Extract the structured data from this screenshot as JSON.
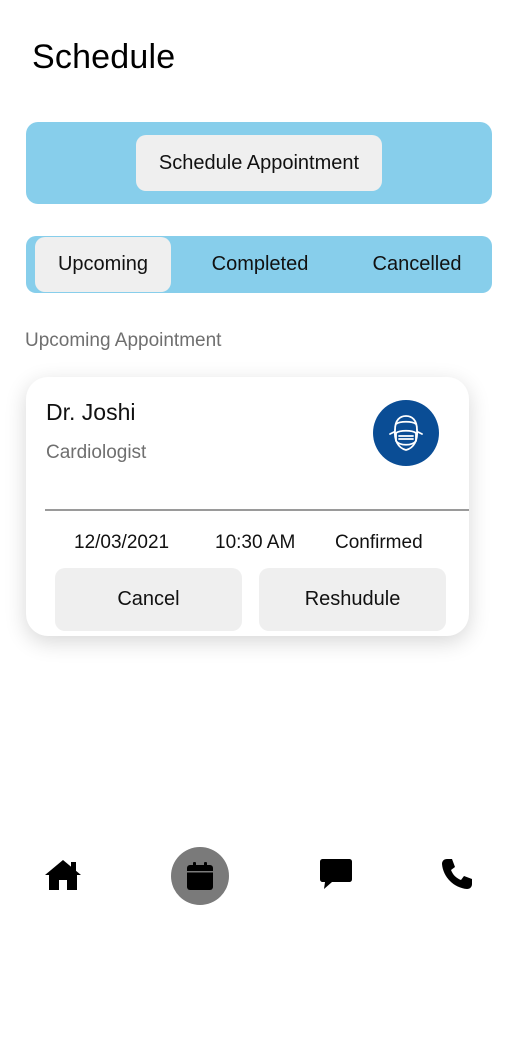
{
  "header": {
    "title": "Schedule"
  },
  "schedule_button": {
    "label": "Schedule Appointment"
  },
  "tabs": [
    {
      "label": "Upcoming",
      "active": true
    },
    {
      "label": "Completed",
      "active": false
    },
    {
      "label": "Cancelled",
      "active": false
    }
  ],
  "section": {
    "label": "Upcoming Appointment"
  },
  "appointment": {
    "doctor": "Dr. Joshi",
    "specialty": "Cardiologist",
    "avatar_icon": "doctor-mask-icon",
    "date": "12/03/2021",
    "time": "10:30 AM",
    "status": "Confirmed",
    "cancel_label": "Cancel",
    "reschedule_label": "Reshudule"
  },
  "bottom_nav": [
    {
      "icon": "home-icon",
      "active": false
    },
    {
      "icon": "calendar-icon",
      "active": true
    },
    {
      "icon": "chat-icon",
      "active": false
    },
    {
      "icon": "phone-icon",
      "active": false
    }
  ],
  "colors": {
    "accent": "#87ceeb",
    "button_bg": "#efefef",
    "avatar_bg": "#0a4d95",
    "nav_active_bg": "#7a7a7a"
  }
}
